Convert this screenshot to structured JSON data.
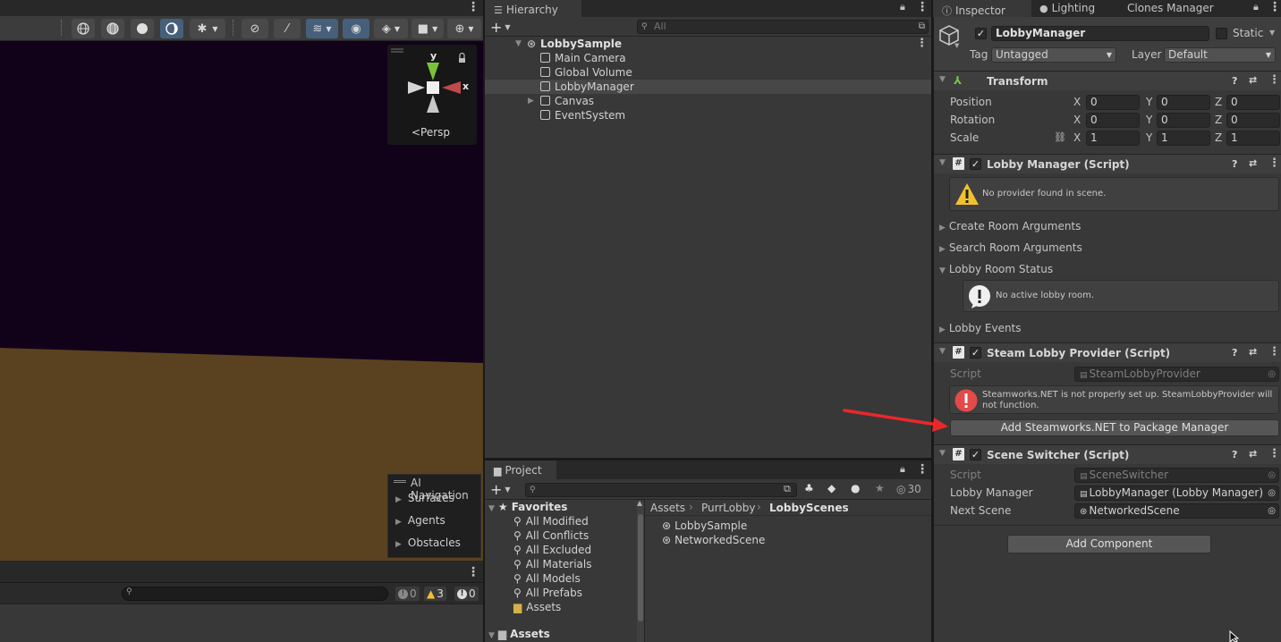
{
  "scene": {
    "persp_label": "<Persp",
    "axes": {
      "y": "y",
      "x": "x"
    },
    "ai_navigation": {
      "title": "AI Navigation",
      "items": [
        "Surfaces",
        "Agents",
        "Obstacles"
      ]
    },
    "console_counts": {
      "info": "0",
      "warnings": "3",
      "errors": "0"
    }
  },
  "hierarchy": {
    "tab": "Hierarchy",
    "search_placeholder": "All",
    "add_label": "+",
    "scene_name": "LobbySample",
    "items": [
      "Main Camera",
      "Global Volume",
      "LobbyManager",
      "Canvas",
      "EventSystem"
    ]
  },
  "project": {
    "tab": "Project",
    "add_label": "+",
    "hidden_count": "30",
    "favorites_title": "Favorites",
    "favorites": [
      "All Modified",
      "All Conflicts",
      "All Excluded",
      "All Materials",
      "All Models",
      "All Prefabs",
      "Assets"
    ],
    "assets_title": "Assets",
    "breadcrumb": [
      "Assets",
      "PurrLobby",
      "LobbyScenes"
    ],
    "files": [
      "LobbySample",
      "NetworkedScene"
    ]
  },
  "inspector": {
    "tabs": [
      "Inspector",
      "Lighting",
      "Clones Manager"
    ],
    "object_name": "LobbyManager",
    "static_label": "Static",
    "tag_label": "Tag",
    "tag_value": "Untagged",
    "layer_label": "Layer",
    "layer_value": "Default",
    "transform": {
      "title": "Transform",
      "rows": [
        {
          "label": "Position",
          "x": "0",
          "y": "0",
          "z": "0"
        },
        {
          "label": "Rotation",
          "x": "0",
          "y": "0",
          "z": "0"
        },
        {
          "label": "Scale",
          "x": "1",
          "y": "1",
          "z": "1"
        }
      ],
      "axis_labels": [
        "X",
        "Y",
        "Z"
      ]
    },
    "lobby_manager": {
      "title": "Lobby Manager (Script)",
      "warning": "No provider found in scene.",
      "sections": [
        "Create Room Arguments",
        "Search Room Arguments",
        "Lobby Room Status"
      ],
      "status_info": "No active lobby room.",
      "events": "Lobby Events"
    },
    "steam_provider": {
      "title": "Steam Lobby Provider (Script)",
      "script_label": "Script",
      "script_value": "SteamLobbyProvider",
      "error": "Steamworks.NET is not properly set up. SteamLobbyProvider will not function.",
      "button": "Add Steamworks.NET to Package Manager"
    },
    "scene_switcher": {
      "title": "Scene Switcher (Script)",
      "script_label": "Script",
      "script_value": "SceneSwitcher",
      "lobby_manager_label": "Lobby Manager",
      "lobby_manager_value": "LobbyManager (Lobby Manager)",
      "next_scene_label": "Next Scene",
      "next_scene_value": "NetworkedScene"
    },
    "add_component": "Add Component"
  },
  "colors": {
    "sky": "#11021a",
    "ground": "#5a4220",
    "accent_blue": "#46607c",
    "warning_yellow": "#f2c12e",
    "error_red": "#e34a4a",
    "arrow_red": "#e8282b"
  }
}
